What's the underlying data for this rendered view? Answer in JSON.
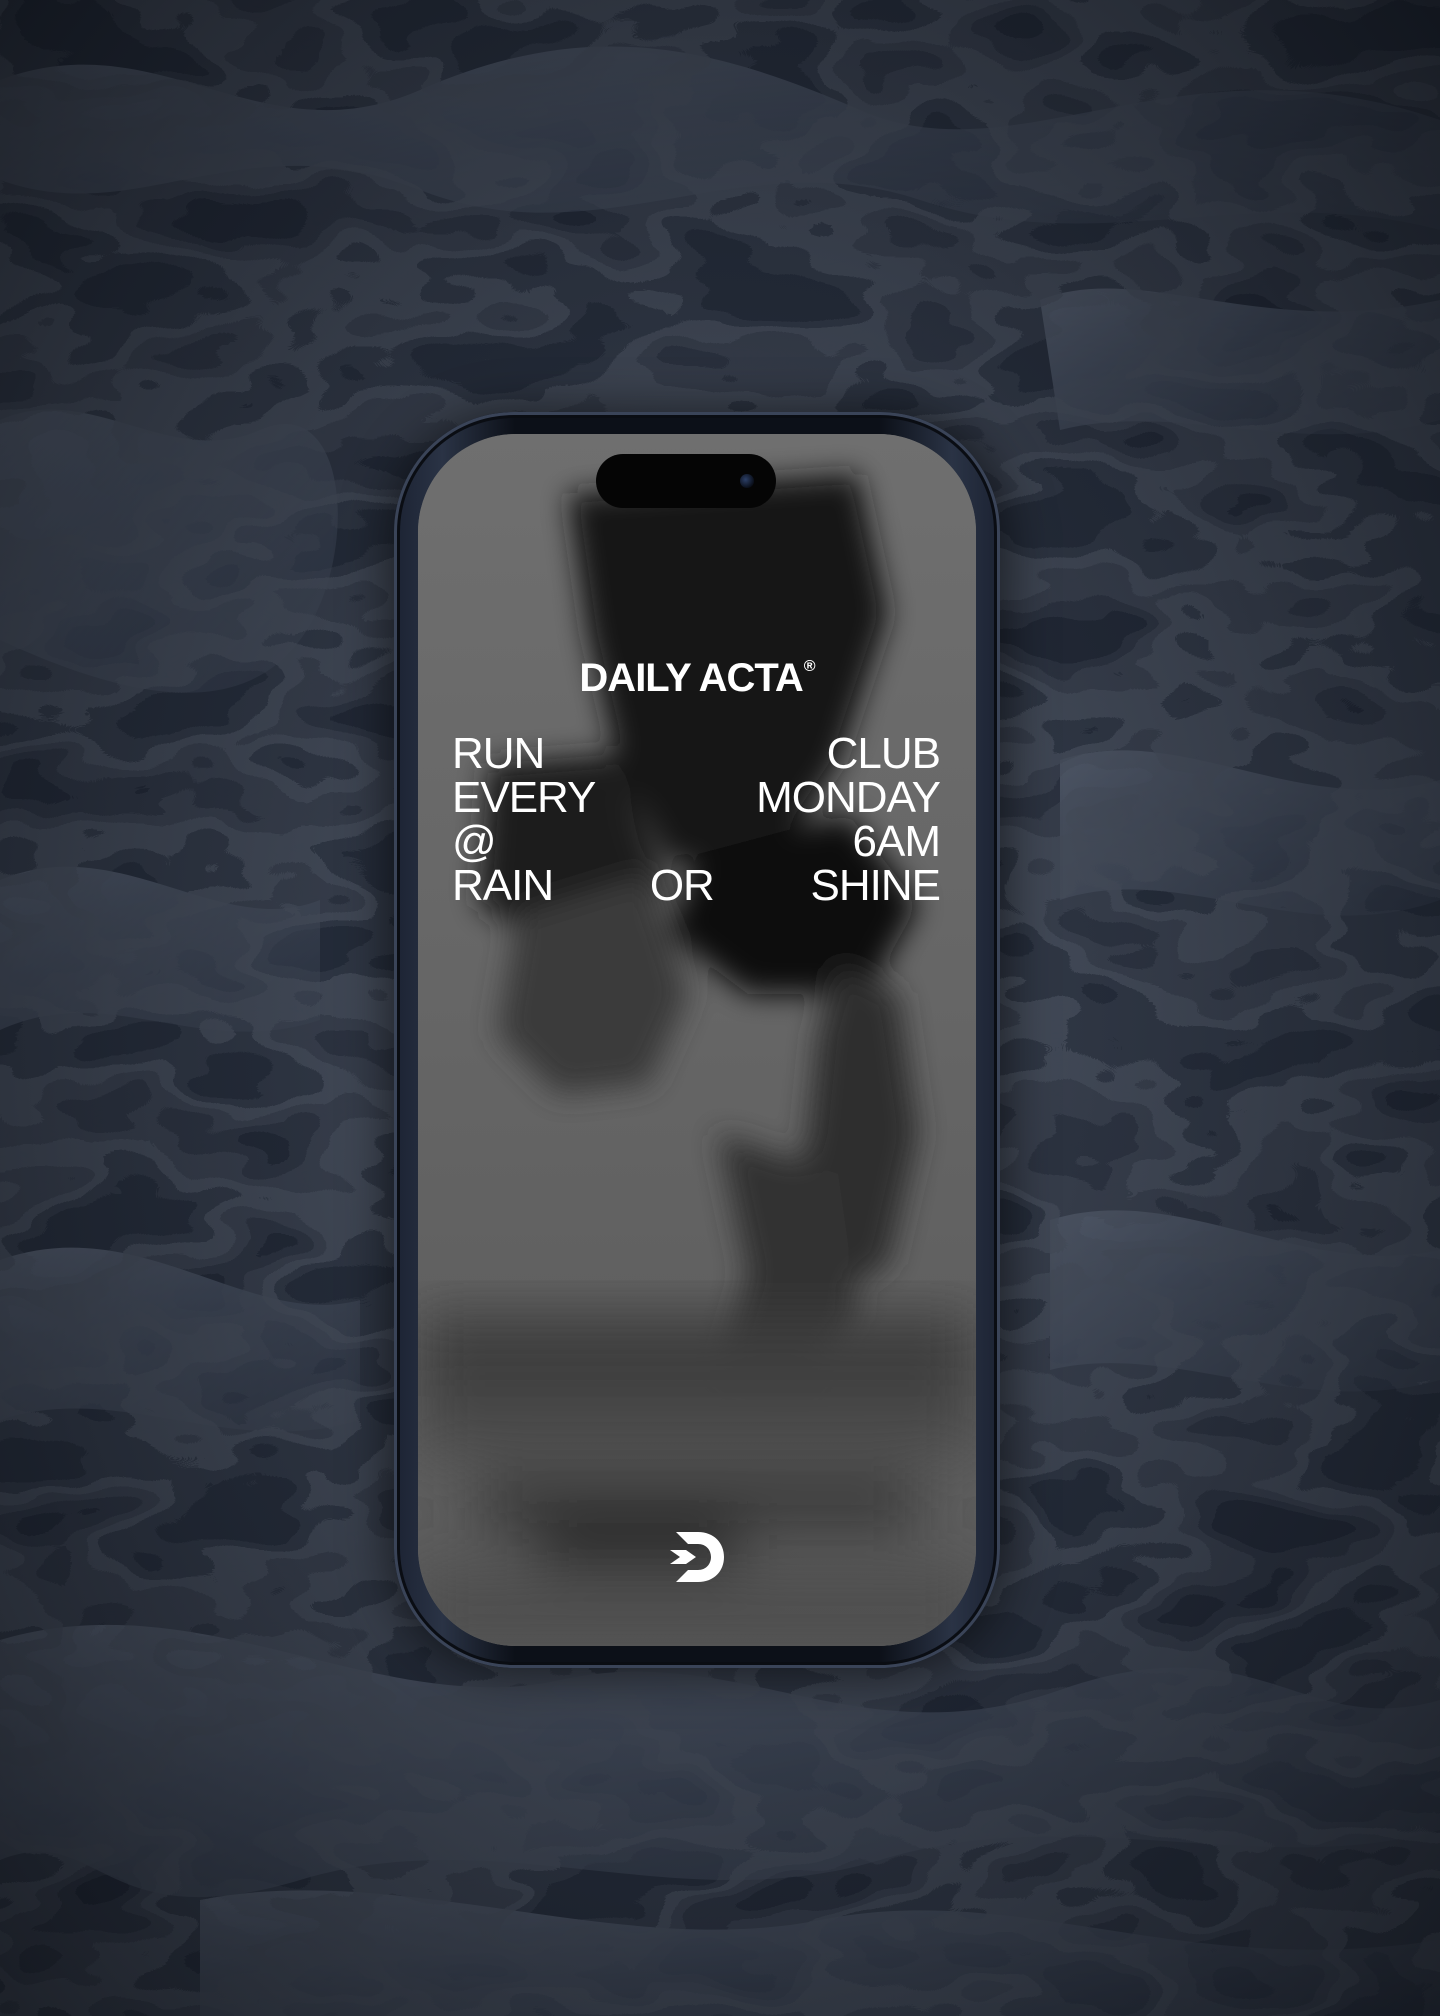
{
  "poster": {
    "brand": "DAILY ACTA",
    "registered_mark": "®",
    "lines": [
      [
        "RUN",
        "CLUB"
      ],
      [
        "EVERY",
        "MONDAY"
      ],
      [
        "@",
        "6AM"
      ],
      [
        "RAIN",
        "OR",
        "SHINE"
      ]
    ],
    "logo_icon": "daily-acta-d-arrow-logo"
  },
  "colors": {
    "background": "#1b2029",
    "text": "#ffffff",
    "phone_frame": "#1c2333",
    "screen_tone": "#6b6b6b"
  }
}
